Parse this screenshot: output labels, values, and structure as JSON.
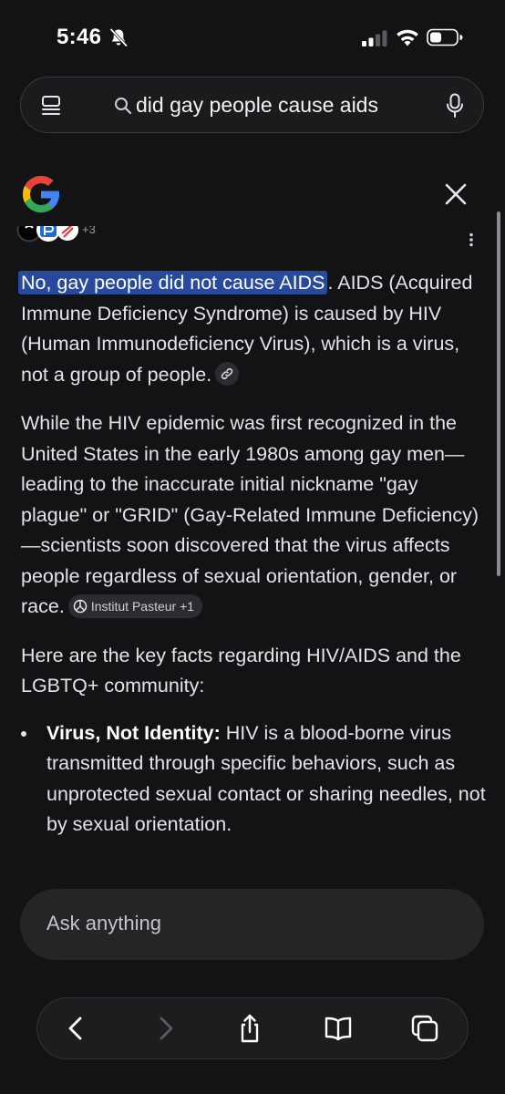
{
  "status_bar": {
    "time": "5:46",
    "icons": [
      "bell-slash-icon",
      "signal-icon",
      "wifi-icon",
      "battery-icon"
    ]
  },
  "search": {
    "query": "did gay people cause aids",
    "icons": [
      "menu-icon",
      "search-icon",
      "mic-icon"
    ]
  },
  "header": {
    "logo": "google-g-logo",
    "close_icon": "close-icon"
  },
  "answer": {
    "p1_highlight": "No, gay people did not cause AIDS",
    "p1_rest": ". AIDS (Acquired Immune Deficiency Syndrome) is caused by HIV (Human Immunodeficiency Virus), which is a virus, not a group of people.",
    "p2": "While the HIV epidemic was first recognized in the United States in the early 1980s among gay men—leading to the inaccurate initial nickname \"gay plague\" or \"GRID\" (Gay-Related Immune Deficiency)—scientists soon discovered that the virus affects people regardless of sexual orientation, gender, or race.",
    "p2_source": "Institut Pasteur +1",
    "p3": "Here are the key facts regarding HIV/AIDS and the LGBTQ+ community:",
    "bullets": [
      {
        "term": "Virus, Not Identity:",
        "text": " HIV is a blood-borne virus transmitted through specific behaviors, such as unprotected sexual contact or sharing needles, not by sexual orientation."
      }
    ]
  },
  "ask": {
    "placeholder": "Ask anything"
  },
  "toolbar": {
    "buttons": [
      "back-icon",
      "forward-icon",
      "share-icon",
      "bookmarks-icon",
      "tabs-icon"
    ]
  },
  "colors": {
    "background": "#131315",
    "highlight": "#284a9c",
    "text": "#e3e3e8"
  }
}
